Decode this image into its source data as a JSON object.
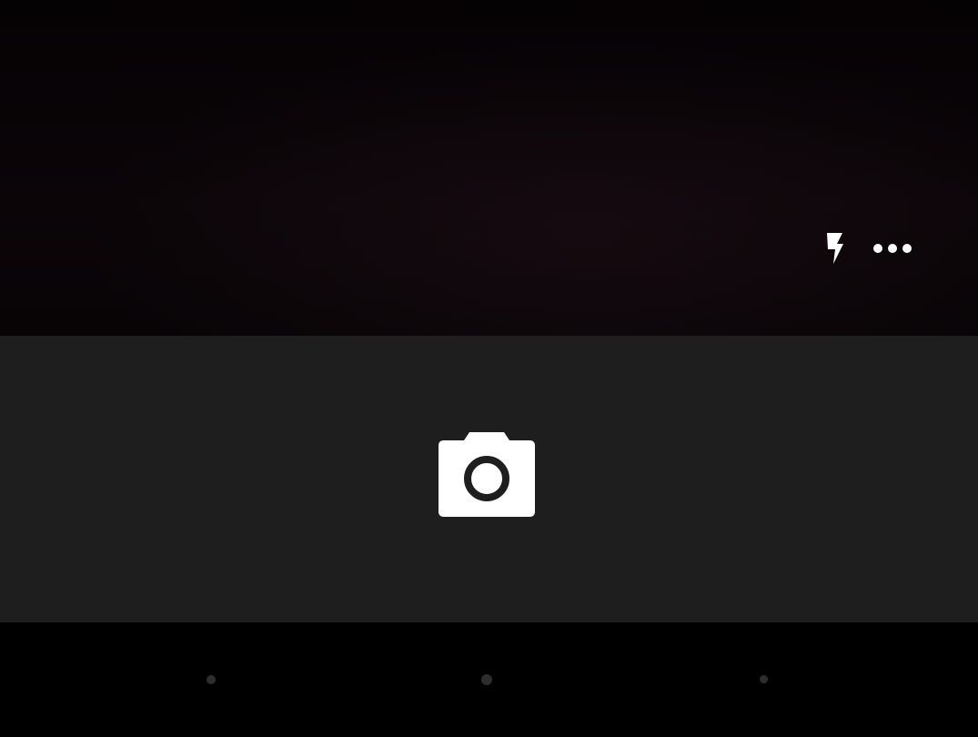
{
  "app": {
    "name": "Camera"
  },
  "viewfinder": {
    "top_controls": [
      {
        "name": "flash",
        "icon": "flash-icon"
      },
      {
        "name": "more",
        "icon": "more-icon"
      }
    ]
  },
  "controls": {
    "shutter": {
      "icon": "camera-icon"
    }
  },
  "navigation": {
    "buttons": [
      {
        "name": "back"
      },
      {
        "name": "home"
      },
      {
        "name": "recents"
      }
    ]
  },
  "colors": {
    "viewfinder": "#080406",
    "panel": "#1e1e1e",
    "icon": "#ffffff",
    "nav_bar": "#000000",
    "nav_dot": "#2e2e2e"
  }
}
